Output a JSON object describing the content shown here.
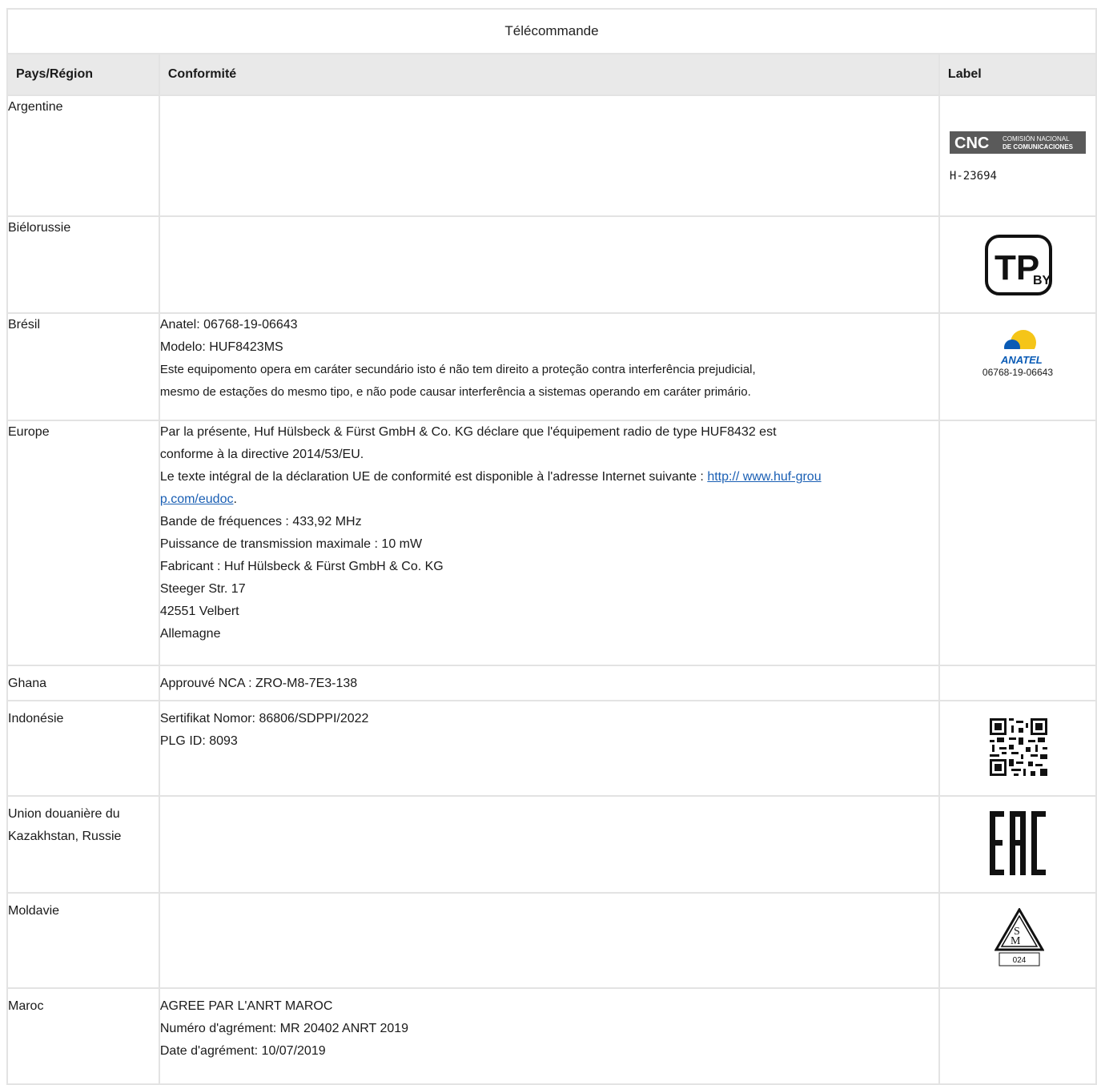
{
  "caption": "Télécommande",
  "headers": {
    "country": "Pays/Région",
    "compliance": "Conformité",
    "label": "Label"
  },
  "rows": {
    "argentina": {
      "country": "Argentine",
      "label_logo": {
        "mark": "CNC",
        "line1": "COMISIÓN NACIONAL",
        "line2": "DE COMUNICACIONES"
      },
      "label_code": "H-23694"
    },
    "belarus": {
      "country": "Biélorussie",
      "label_logo": {
        "text": "TP",
        "sub": "BY"
      }
    },
    "brazil": {
      "country": "Brésil",
      "lines": [
        "Anatel: 06768-19-06643",
        "Modelo: HUF8423MS",
        "Este equipomento opera em caráter secundário isto é não tem direito a proteção contra interferência prejudicial,",
        "mesmo de estações do mesmo tipo, e não pode causar interferência a sistemas operando em caráter primário."
      ],
      "label_logo": {
        "text": "ANATEL",
        "code": "06768-19-06643"
      }
    },
    "europe": {
      "country": "Europe",
      "line1": "Par la présente, Huf Hülsbeck & Fürst GmbH & Co. KG déclare que l'équipement radio de type HUF8432 est",
      "line2": "conforme à la directive 2014/53/EU.",
      "line3_prefix": "Le texte intégral de la déclaration UE de conformité est disponible à l'adresse Internet suivante : ",
      "link_part1": "http:// www.huf-grou",
      "link_part2": "p.com/eudoc",
      "line4_suffix": ".",
      "lines_after": [
        "Bande de fréquences : 433,92 MHz",
        "Puissance de transmission maximale : 10 mW",
        "Fabricant : Huf Hülsbeck & Fürst GmbH & Co. KG",
        "Steeger Str. 17",
        "42551 Velbert",
        "Allemagne"
      ]
    },
    "ghana": {
      "country": "Ghana",
      "lines": [
        "Approuvé NCA : ZRO-M8-7E3-138"
      ]
    },
    "indonesia": {
      "country": "Indonésie",
      "lines": [
        "Sertifikat Nomor: 86806/SDPPI/2022",
        "PLG ID: 8093"
      ]
    },
    "eac": {
      "country_line1": "Union douanière du",
      "country_line2": "Kazakhstan, Russie",
      "label_logo": {
        "text": "EAC"
      }
    },
    "moldova": {
      "country": "Moldavie",
      "label_logo": {
        "text": "SM",
        "code": "024"
      }
    },
    "morocco": {
      "country": "Maroc",
      "lines": [
        "AGREE PAR L'ANRT MAROC",
        "Numéro d'agrément: MR 20402 ANRT 2019",
        "Date d'agrément: 10/07/2019"
      ]
    }
  },
  "colors": {
    "header_bg": "#e9e9e9",
    "border": "#e3e3e3",
    "link": "#1a5fb4",
    "anatel_blue": "#0a5bb5",
    "anatel_yellow": "#f5c518"
  }
}
